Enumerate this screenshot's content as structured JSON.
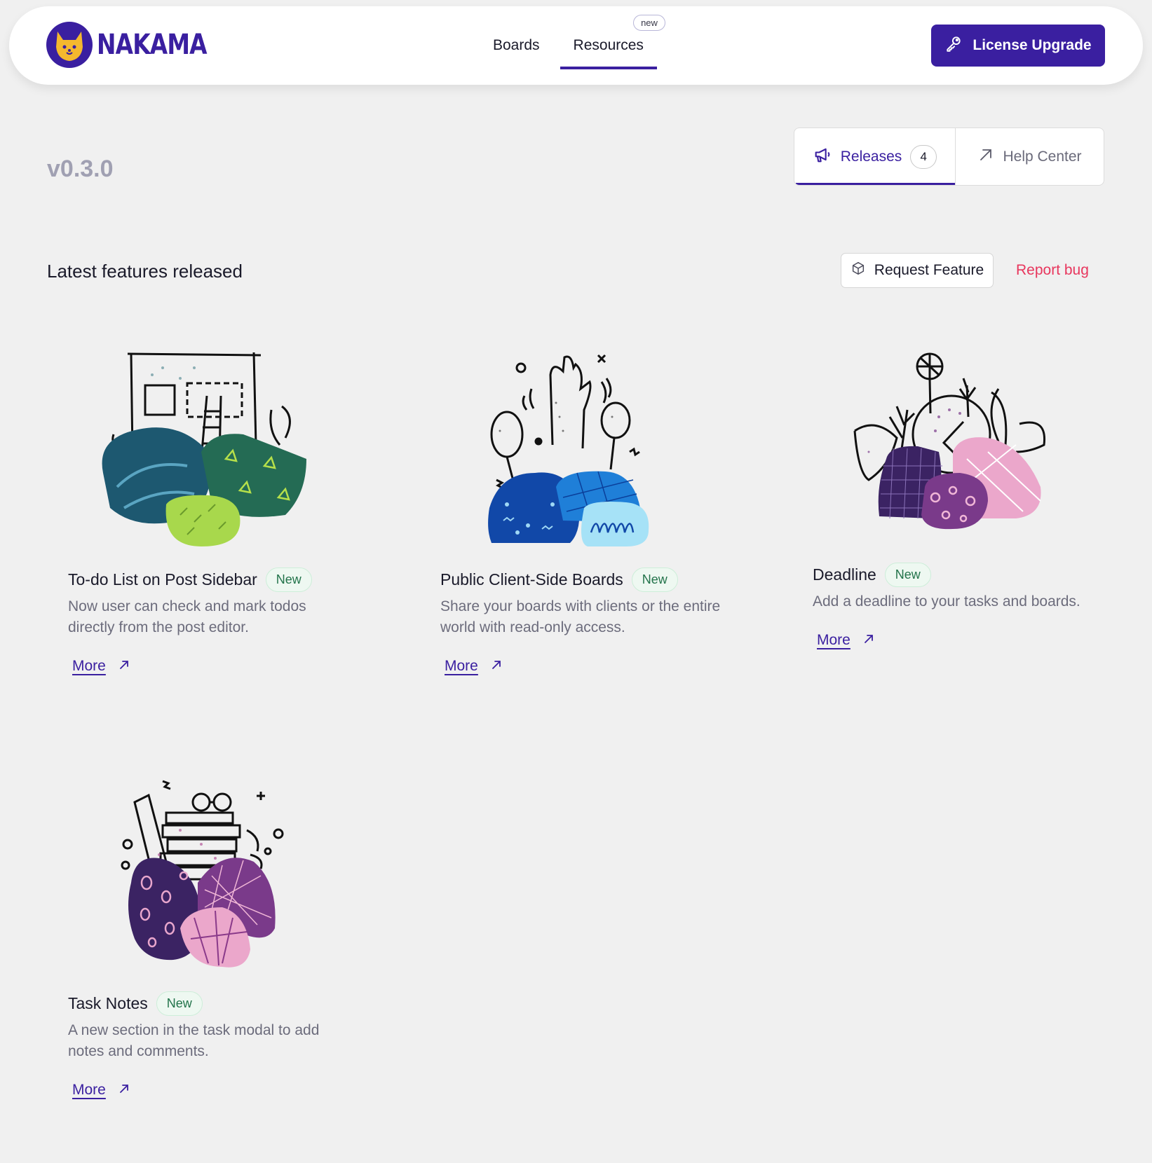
{
  "header": {
    "logo_text": "NAKAMA",
    "nav": [
      {
        "label": "Boards",
        "badge": ""
      },
      {
        "label": "Resources",
        "badge": "new"
      }
    ],
    "upgrade_label": "License Upgrade"
  },
  "version": "v0.3.0",
  "tabs": {
    "releases_label": "Releases",
    "releases_count": "4",
    "help_label": "Help Center"
  },
  "section": {
    "title": "Latest features released",
    "request_label": "Request Feature",
    "report_label": "Report bug"
  },
  "features": [
    {
      "title": "To-do List on Post Sidebar",
      "badge": "New",
      "description": "Now user can check and mark todos directly from the post editor.",
      "more": "More"
    },
    {
      "title": "Public Client-Side Boards",
      "badge": "New",
      "description": "Share your boards with clients or the entire world with read-only access.",
      "more": "More"
    },
    {
      "title": "Deadline",
      "badge": "New",
      "description": "Add a deadline to your tasks and boards.",
      "more": "More"
    },
    {
      "title": "Task Notes",
      "badge": "New",
      "description": "A new section in the task modal to add notes and comments.",
      "more": "More"
    }
  ],
  "colors": {
    "brand": "#3a1fa0",
    "accent_red": "#e8365d",
    "new_badge_text": "#22734a",
    "page_bg": "#f0f0f0"
  }
}
